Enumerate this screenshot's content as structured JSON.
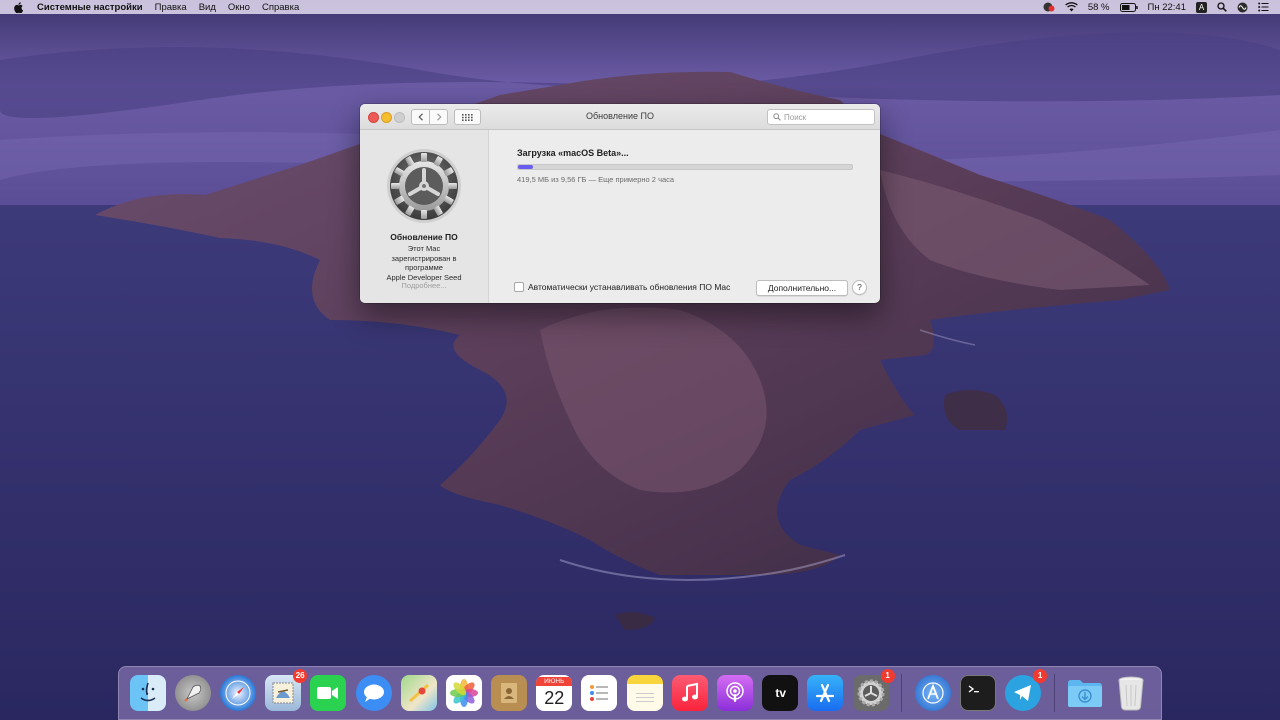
{
  "menubar": {
    "app_name": "Системные настройки",
    "menus": [
      "Правка",
      "Вид",
      "Окно",
      "Справка"
    ],
    "battery_percent": "58 %",
    "clock": "Пн 22:41",
    "input_source": "A",
    "icons": [
      "apple-icon",
      "notification-app-icon",
      "wifi-icon",
      "battery-icon",
      "input-source-icon",
      "spotlight-icon",
      "siri-icon",
      "control-list-icon"
    ]
  },
  "window": {
    "title": "Обновление ПО",
    "search_placeholder": "Поиск",
    "sidebar": {
      "title": "Обновление ПО",
      "desc_lines": [
        "Этот Mac",
        "зарегистрирован в",
        "программе",
        "Apple Developer Seed"
      ],
      "more_link": "Подробнее..."
    },
    "download": {
      "title": "Загрузка «macOS Beta»...",
      "status": "419,5 МБ из 9,56 ГБ — Еще примерно 2 часа",
      "progress": 0.044
    },
    "auto_update_label": "Автоматически устанавливать обновления ПО Mac",
    "auto_update_checked": false,
    "advanced_button": "Дополнительно...",
    "help_button": "?"
  },
  "dock": {
    "apps": [
      {
        "name": "finder",
        "running": true,
        "badge": null
      },
      {
        "name": "launchpad",
        "running": false,
        "badge": null
      },
      {
        "name": "safari",
        "running": true,
        "badge": null
      },
      {
        "name": "mail",
        "running": true,
        "badge": "26"
      },
      {
        "name": "facetime",
        "running": false,
        "badge": null
      },
      {
        "name": "messages",
        "running": false,
        "badge": null
      },
      {
        "name": "maps",
        "running": false,
        "badge": null
      },
      {
        "name": "photos",
        "running": false,
        "badge": null
      },
      {
        "name": "contacts",
        "running": false,
        "badge": null
      },
      {
        "name": "calendar",
        "running": false,
        "badge": null
      },
      {
        "name": "reminders",
        "running": false,
        "badge": null
      },
      {
        "name": "notes",
        "running": false,
        "badge": null
      },
      {
        "name": "music",
        "running": true,
        "badge": null
      },
      {
        "name": "podcasts",
        "running": false,
        "badge": null
      },
      {
        "name": "tv",
        "running": false,
        "badge": null
      },
      {
        "name": "app-store",
        "running": false,
        "badge": null
      },
      {
        "name": "system-preferences",
        "running": true,
        "badge": "1"
      },
      {
        "name": "xcode-instruments",
        "running": false,
        "badge": null
      },
      {
        "name": "terminal",
        "running": true,
        "badge": null
      },
      {
        "name": "telegram",
        "running": true,
        "badge": "1"
      },
      {
        "name": "downloads-folder",
        "running": false,
        "badge": null
      },
      {
        "name": "trash",
        "running": false,
        "badge": null
      }
    ],
    "calendar_month": "ИЮНЬ",
    "calendar_day": "22",
    "tv_label": "tv"
  },
  "colors": {
    "accent": "#6a5cf0",
    "close": "#ee5b56",
    "minimize": "#f5bd30",
    "badge": "#f23b30"
  }
}
